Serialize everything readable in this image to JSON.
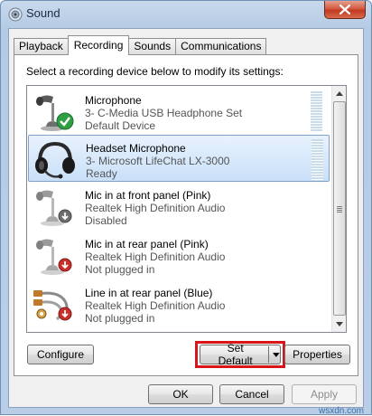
{
  "window": {
    "title": "Sound",
    "close_glyph": "✕"
  },
  "tabs": [
    {
      "label": "Playback",
      "active": false
    },
    {
      "label": "Recording",
      "active": true
    },
    {
      "label": "Sounds",
      "active": false
    },
    {
      "label": "Communications",
      "active": false
    }
  ],
  "instruction": "Select a recording device below to modify its settings:",
  "devices": [
    {
      "name": "Microphone",
      "line1": "3- C-Media USB Headphone Set",
      "line2": "Default Device",
      "icon": "microphone-icon",
      "status": "default-check",
      "selected": false
    },
    {
      "name": "Headset Microphone",
      "line1": "3- Microsoft LifeChat LX-3000",
      "line2": "Ready",
      "icon": "headset-icon",
      "status": "none",
      "selected": true
    },
    {
      "name": "Mic in at front panel (Pink)",
      "line1": "Realtek High Definition Audio",
      "line2": "Disabled",
      "icon": "microphone-icon",
      "status": "disabled-arrow",
      "selected": false
    },
    {
      "name": "Mic in at rear panel (Pink)",
      "line1": "Realtek High Definition Audio",
      "line2": "Not plugged in",
      "icon": "microphone-icon",
      "status": "unplugged-arrow",
      "selected": false
    },
    {
      "name": "Line in at rear panel (Blue)",
      "line1": "Realtek High Definition Audio",
      "line2": "Not plugged in",
      "icon": "audio-cable-icon",
      "status": "unplugged-arrow",
      "selected": false
    }
  ],
  "buttons": {
    "configure": "Configure",
    "set_default": "Set Default",
    "properties": "Properties",
    "ok": "OK",
    "cancel": "Cancel",
    "apply": "Apply"
  },
  "watermark": "wsxdn.com",
  "colors": {
    "highlight": "#d7151a",
    "check_green": "#2ea043",
    "arrow_red": "#c9302c"
  }
}
